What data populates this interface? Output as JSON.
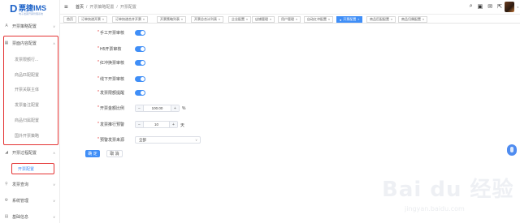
{
  "brand": {
    "logo_letter": "D",
    "name": "票捷IMS",
    "subtitle": "电子发票开票管理系统"
  },
  "sidebar": {
    "items": [
      {
        "label": "开票策略配置",
        "icon": "A",
        "caret": "∨"
      },
      {
        "label": "票面内容配置",
        "icon": "▦",
        "caret": "∧"
      },
      {
        "label": "开票过程配置",
        "icon": "◢",
        "caret": "∧"
      },
      {
        "label": "发票查询",
        "icon": "⚲",
        "caret": "∨"
      },
      {
        "label": "系统管理",
        "icon": "⚙",
        "caret": "∨"
      },
      {
        "label": "基础信息",
        "icon": "▤",
        "caret": "∨"
      }
    ],
    "content_subitems": [
      "发票限额行...",
      "商品匹配配置",
      "开票关联主体",
      "发票备注配置",
      "商品归属配置",
      "国外开票策略"
    ],
    "process_subitems": [
      "开票配置"
    ]
  },
  "header": {
    "menu_icon": "≡",
    "breadcrumb": [
      "首页",
      "开票策略配置",
      "开票配置"
    ],
    "icons": [
      "⌕",
      "▣",
      "✉",
      "⇱"
    ],
    "avatar_caret": "▾"
  },
  "tabs": [
    {
      "label": "首页",
      "closable": false
    },
    {
      "label": "订单快递开票",
      "closable": true
    },
    {
      "label": "订单快递合并开票",
      "closable": true
    },
    {
      "label": "开票策略列表",
      "closable": true
    },
    {
      "label": "开票总合计列表",
      "closable": true
    },
    {
      "label": "企业配置",
      "closable": true
    },
    {
      "label": "店铺管理",
      "closable": true
    },
    {
      "label": "用户管理",
      "closable": true
    },
    {
      "label": "自动红冲配置",
      "closable": true
    },
    {
      "label": "开票配置",
      "closable": true,
      "active": true
    },
    {
      "label": "商品匹配配置",
      "closable": true
    },
    {
      "label": "商品归属配置",
      "closable": true
    }
  ],
  "form": {
    "toggles": [
      {
        "label": "手工开票审核",
        "required": true,
        "on": true
      },
      {
        "label": "H5开票审核",
        "required": true,
        "on": true
      },
      {
        "label": "红冲换票审核",
        "required": true,
        "on": true
      },
      {
        "label": "线下开票审核",
        "required": true,
        "on": true
      },
      {
        "label": "发票限额提醒",
        "required": true,
        "on": true
      }
    ],
    "ratio": {
      "label": "开票金额比例",
      "required": true,
      "minus": "−",
      "value": "100.00",
      "plus": "+",
      "unit": "%"
    },
    "days": {
      "label": "发票推行预警",
      "required": true,
      "minus": "−",
      "value": "10",
      "plus": "+",
      "unit": "天"
    },
    "source": {
      "label": "预警发票来源",
      "required": true,
      "value": "全部",
      "caret": "∨"
    },
    "confirm_label": "确 定",
    "cancel_label": "取 消",
    "required_mark": "*"
  },
  "watermark": {
    "text": "Bai du 经验",
    "sub": "jingyan.baidu.com"
  },
  "colors": {
    "accent": "#3f8ef7",
    "highlight_box": "#e43434"
  }
}
